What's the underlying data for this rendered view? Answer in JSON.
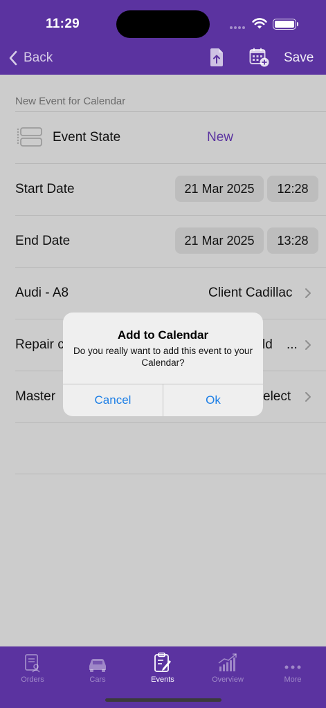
{
  "status_bar": {
    "time": "11:29"
  },
  "nav": {
    "back_label": "Back",
    "save_label": "Save",
    "icons": [
      "export-file-icon",
      "calendar-add-icon"
    ]
  },
  "form": {
    "section_title": "New Event for Calendar",
    "event_state": {
      "label": "Event State",
      "value": "New"
    },
    "start": {
      "label": "Start Date",
      "date": "21 Mar 2025",
      "time": "12:28"
    },
    "end": {
      "label": "End Date",
      "date": "21 Mar 2025",
      "time": "13:28"
    },
    "car": {
      "label": "Audi - A8",
      "value": "Client Cadillac"
    },
    "repair": {
      "label": "Repair c",
      "value": "ld",
      "ellipsis": "..."
    },
    "master": {
      "label": "Master",
      "value": "elect"
    }
  },
  "dialog": {
    "title": "Add to Calendar",
    "message": "Do you really want to add this event to your Calendar?",
    "cancel_label": "Cancel",
    "ok_label": "Ok"
  },
  "tabs": [
    {
      "label": "Orders",
      "icon": "orders-icon",
      "active": false
    },
    {
      "label": "Cars",
      "icon": "car-icon",
      "active": false
    },
    {
      "label": "Events",
      "icon": "events-icon",
      "active": true
    },
    {
      "label": "Overview",
      "icon": "chart-icon",
      "active": false
    },
    {
      "label": "More",
      "icon": "more-icon",
      "active": false
    }
  ],
  "colors": {
    "primary": "#5b33a0",
    "accent_text": "#5b33a0",
    "dialog_button": "#1d7fe6",
    "overlay_background": "#cccccc"
  }
}
